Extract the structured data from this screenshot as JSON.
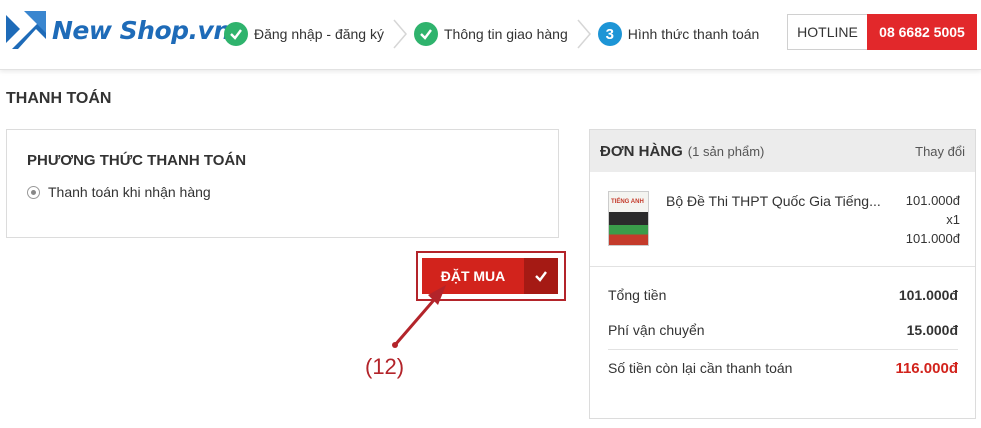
{
  "brand": {
    "logo_text": "New Shop.vn",
    "logo_icon": "arrow-logo-icon",
    "colors": {
      "brand_blue": "#1e6bb8",
      "accent_red": "#d2231c",
      "step_done": "#2fb36d",
      "step_current": "#1d95d6"
    }
  },
  "steps": [
    {
      "label": "Đăng nhập - đăng ký",
      "status": "done",
      "icon": "check-circle-icon"
    },
    {
      "label": "Thông tin giao hàng",
      "status": "done",
      "icon": "check-circle-icon"
    },
    {
      "label": "Hình thức thanh toán",
      "status": "current",
      "number": "3"
    }
  ],
  "hotline": {
    "label": "HOTLINE",
    "number": "08 6682 5005"
  },
  "page": {
    "title": "THANH TOÁN"
  },
  "payment": {
    "title": "PHƯƠNG THỨC THANH TOÁN",
    "options": [
      {
        "label": "Thanh toán khi nhận hàng",
        "selected": true
      }
    ]
  },
  "order_button": {
    "label": "ĐẶT MUA",
    "icon": "check-icon"
  },
  "annotation": {
    "label": "(12)"
  },
  "order": {
    "title": "ĐƠN HÀNG",
    "count_text": "(1 sản phẩm)",
    "change_label": "Thay đổi",
    "items": [
      {
        "name": "Bộ Đề Thi THPT Quốc Gia Tiếng...",
        "price": "101.000đ",
        "qty": "x1",
        "total": "101.000đ",
        "thumb_text": "TIẾNG ANH"
      }
    ],
    "subtotal_label": "Tổng tiền",
    "subtotal_value": "101.000đ",
    "shipping_label": "Phí vận chuyển",
    "shipping_value": "15.000đ",
    "remaining_label": "Số tiền còn lại cần thanh toán",
    "remaining_value": "116.000đ"
  }
}
